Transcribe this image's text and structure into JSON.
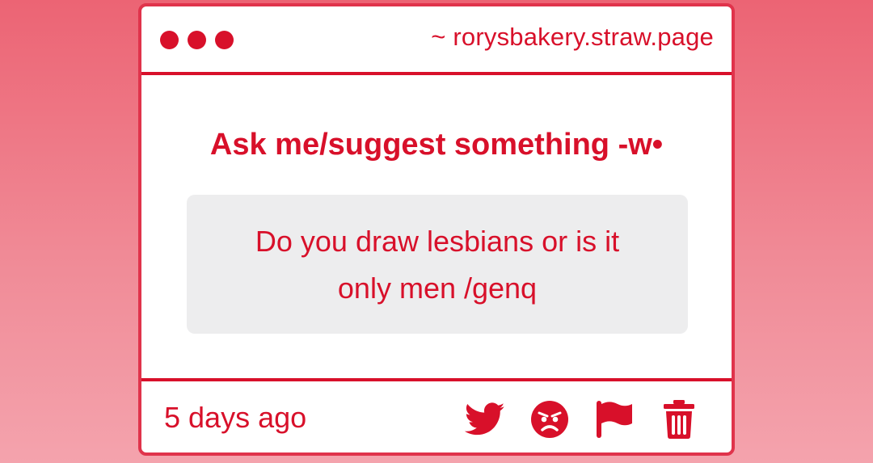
{
  "window": {
    "url": "~ rorysbakery.straw.page"
  },
  "prompt": {
    "title": "Ask me/suggest something -w•"
  },
  "question": {
    "text": "Do you draw lesbians or is it only men /genq"
  },
  "footer": {
    "timestamp": "5 days ago",
    "actions": [
      {
        "icon": "twitter-icon"
      },
      {
        "icon": "angry-face-icon"
      },
      {
        "icon": "flag-icon"
      },
      {
        "icon": "trash-icon"
      }
    ]
  },
  "colors": {
    "accent": "#d8102a",
    "card_border": "#e0334b",
    "question_background": "#ededee",
    "background_top": "#ec6474",
    "background_bottom": "#f4a3ad"
  }
}
